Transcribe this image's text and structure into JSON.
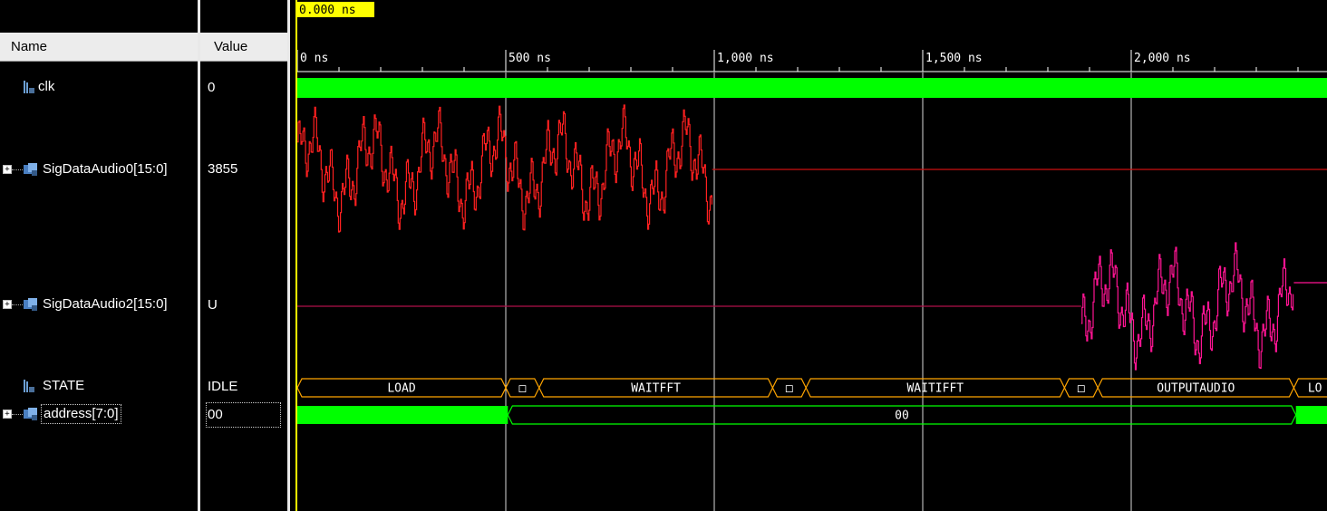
{
  "cursor": {
    "label": "0.000 ns"
  },
  "columns": {
    "name": "Name",
    "value": "Value"
  },
  "signals": [
    {
      "name": "clk",
      "value": "0",
      "kind": "bit",
      "icon": "bit-signal-icon"
    },
    {
      "name": "SigDataAudio0[15:0]",
      "value": "3855",
      "kind": "bus",
      "icon": "bus-signal-icon"
    },
    {
      "name": "SigDataAudio2[15:0]",
      "value": "U",
      "kind": "bus",
      "icon": "bus-signal-icon"
    },
    {
      "name": "STATE",
      "value": "IDLE",
      "kind": "bit",
      "icon": "bit-signal-icon"
    },
    {
      "name": "address[7:0]",
      "value": "00",
      "kind": "bus",
      "icon": "bus-signal-icon",
      "selected": true
    }
  ],
  "timeline": {
    "unit": "ns",
    "start": 0,
    "end": 2370,
    "major_ticks": [
      {
        "t": 0,
        "label": "0 ns"
      },
      {
        "t": 500,
        "label": "500 ns"
      },
      {
        "t": 1000,
        "label": "1,000 ns"
      },
      {
        "t": 1500,
        "label": "1,500 ns"
      },
      {
        "t": 2000,
        "label": "2,000 ns"
      }
    ],
    "minor_tick_step": 100
  },
  "waves": {
    "clk": {
      "color": "#00ff00"
    },
    "sig0": {
      "color": "#ff2020",
      "active_end": 995,
      "flat_value_color": "#cc1010"
    },
    "sig2": {
      "color": "#ff1493",
      "active_start": 1880,
      "active_end": 2390,
      "flat_color": "#b0104a"
    },
    "state": {
      "color": "#ffa500",
      "segments": [
        {
          "t0": 0,
          "t1": 500,
          "label": "LOAD"
        },
        {
          "t0": 500,
          "t1": 580,
          "label": "□"
        },
        {
          "t0": 580,
          "t1": 1140,
          "label": "WAITFFT"
        },
        {
          "t0": 1140,
          "t1": 1220,
          "label": "□"
        },
        {
          "t0": 1220,
          "t1": 1840,
          "label": "WAITIFFT"
        },
        {
          "t0": 1840,
          "t1": 1920,
          "label": "□"
        },
        {
          "t0": 1920,
          "t1": 2390,
          "label": "OUTPUTAUDIO"
        },
        {
          "t0": 2390,
          "t1": 2500,
          "label": "LO"
        }
      ]
    },
    "address": {
      "color": "#00ff00",
      "segments": [
        {
          "t0": 0,
          "t1": 505,
          "label": "",
          "solid": true
        },
        {
          "t0": 505,
          "t1": 2395,
          "label": "00",
          "solid": false
        },
        {
          "t0": 2395,
          "t1": 2500,
          "label": "",
          "solid": true
        }
      ]
    }
  }
}
